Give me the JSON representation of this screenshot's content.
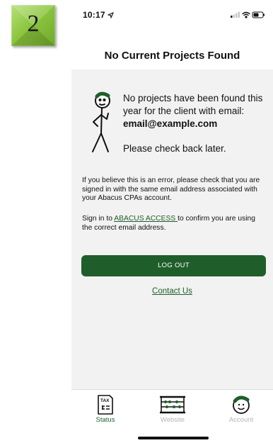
{
  "step_badge": {
    "number": "2"
  },
  "status_bar": {
    "time": "10:17",
    "location_icon": "location-arrow-icon"
  },
  "header": {
    "title": "No Current Projects Found"
  },
  "message": {
    "line_prefix": "No projects have been found this year for the client with email: ",
    "email": "email@example.com",
    "check_back": "Please check back later."
  },
  "info": {
    "error_text": "If you believe this is an error, please check that you are signed in with the same email address associated with your Abacus CPAs account.",
    "signin_prefix": "Sign in to ",
    "signin_link": "ABACUS ACCESS ",
    "signin_suffix": "to confirm you are using the correct email address."
  },
  "actions": {
    "logout_label": "LOG OUT",
    "contact_label": "Contact Us"
  },
  "tabs": [
    {
      "label": "Status",
      "icon": "tax-form-icon",
      "active": true
    },
    {
      "label": "Website",
      "icon": "abacus-icon",
      "active": false
    },
    {
      "label": "Account",
      "icon": "account-face-icon",
      "active": false
    }
  ],
  "colors": {
    "brand_green": "#1f5e2a",
    "badge_green": "#8cc63f",
    "inactive_tab": "#b5b5b5"
  }
}
